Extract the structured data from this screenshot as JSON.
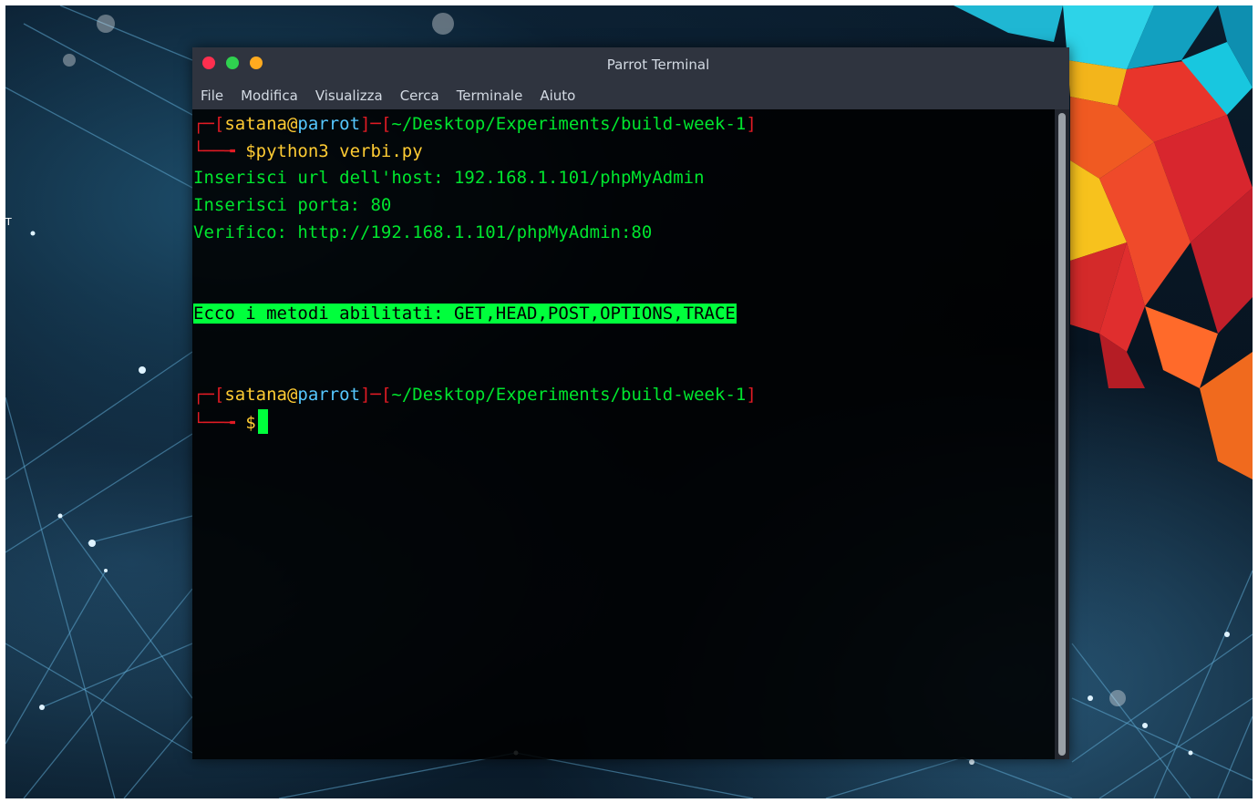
{
  "desktop": {
    "stray_text": "T"
  },
  "window": {
    "title": "Parrot Terminal",
    "menu": [
      "File",
      "Modifica",
      "Visualizza",
      "Cerca",
      "Terminale",
      "Aiuto"
    ]
  },
  "terminal": {
    "prompt1": {
      "bracket_open": "┌─[",
      "user": "satana",
      "at": "@",
      "host": "parrot",
      "sep": "]─[",
      "path": "~/Desktop/Experiments/build-week-1",
      "bracket_close": "]",
      "corner": "└──╼ ",
      "dollar": "$",
      "command": "python3 verbi.py"
    },
    "output": [
      "Inserisci url dell'host: 192.168.1.101/phpMyAdmin",
      "Inserisci porta: 80",
      "Verifico: http://192.168.1.101/phpMyAdmin:80"
    ],
    "highlight": "Ecco i metodi abilitati: GET,HEAD,POST,OPTIONS,TRACE",
    "prompt2": {
      "bracket_open": "┌─[",
      "user": "satana",
      "at": "@",
      "host": "parrot",
      "sep": "]─[",
      "path": "~/Desktop/Experiments/build-week-1",
      "bracket_close": "]",
      "corner": "└──╼ ",
      "dollar": "$"
    }
  },
  "colors": {
    "prompt_red": "#e01b24",
    "user_yellow": "#ffcc33",
    "host_cyan": "#56c8ff",
    "text_green": "#00e62e",
    "highlight_green": "#00ff3c",
    "titlebar": "#2f343f"
  },
  "icons": [
    "close-icon",
    "maximize-icon",
    "minimize-icon",
    "parrot-logo"
  ]
}
